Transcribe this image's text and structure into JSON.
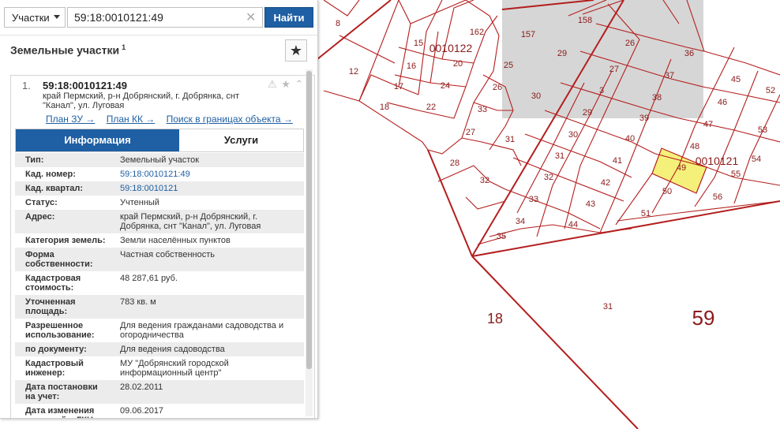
{
  "search": {
    "type_label": "Участки",
    "query": "59:18:0010121:49",
    "clear_icon": "close-icon",
    "find_label": "Найти"
  },
  "panel": {
    "title": "Земельные участки",
    "title_count": "1",
    "favorite_icon": "star-icon"
  },
  "result": {
    "index": "1.",
    "number": "59:18:0010121:49",
    "address": "край Пермский, р-н Добрянский, г. Добрянка, снт \"Канал\", ул. Луговая",
    "status_icons": "⚠ ★ ⌃",
    "links": [
      "План ЗУ →",
      "План КК →",
      "Поиск в границах объекта →"
    ]
  },
  "tabs": {
    "info": "Информация",
    "services": "Услуги"
  },
  "info_rows": [
    {
      "label": "Тип:",
      "value": "Земельный участок",
      "link": false
    },
    {
      "label": "Кад. номер:",
      "value": "59:18:0010121:49",
      "link": true
    },
    {
      "label": "Кад. квартал:",
      "value": "59:18:0010121",
      "link": true
    },
    {
      "label": "Статус:",
      "value": "Учтенный",
      "link": false
    },
    {
      "label": "Адрес:",
      "value": "край Пермский, р-н Добрянский, г. Добрянка, снт \"Канал\", ул. Луговая",
      "link": false
    },
    {
      "label": "Категория земель:",
      "value": "Земли населённых пунктов",
      "link": false
    },
    {
      "label": "Форма собственности:",
      "value": "Частная собственность",
      "link": false
    },
    {
      "label": "Кадастровая стоимость:",
      "value": "48 287,61 руб.",
      "link": false
    },
    {
      "label": "Уточненная площадь:",
      "value": "783 кв. м",
      "link": false
    },
    {
      "label": "Разрешенное использование:",
      "value": "Для ведения гражданами садоводства и огородничества",
      "link": false
    },
    {
      "label": "по документу:",
      "value": "Для ведения садоводства",
      "link": false
    },
    {
      "label": "Кадастровый инженер:",
      "value": "МУ \"Добрянский городской информационный центр\"",
      "link": false
    },
    {
      "label": "Дата постановки на учет:",
      "value": "28.02.2011",
      "link": false
    },
    {
      "label": "Дата изменения сведений в ГКН:",
      "value": "09.06.2017",
      "link": false
    }
  ],
  "map": {
    "line_color": "#b41e1e",
    "highlight_color": "#f5f07a",
    "gray_block_color": "#d6d6d6",
    "quarter_labels": [
      "0010122",
      "0010121"
    ],
    "big_labels": [
      "18",
      "59"
    ],
    "parcel_labels": [
      "8",
      "12",
      "15",
      "16",
      "17",
      "18",
      "20",
      "22",
      "24",
      "25",
      "26",
      "27",
      "28",
      "29",
      "30",
      "31",
      "32",
      "33",
      "34",
      "35",
      "36",
      "37",
      "38",
      "39",
      "40",
      "41",
      "42",
      "43",
      "44",
      "45",
      "46",
      "47",
      "48",
      "49",
      "50",
      "51",
      "52",
      "53",
      "54",
      "55",
      "56",
      "3",
      "157",
      "158",
      "162",
      "31"
    ]
  }
}
